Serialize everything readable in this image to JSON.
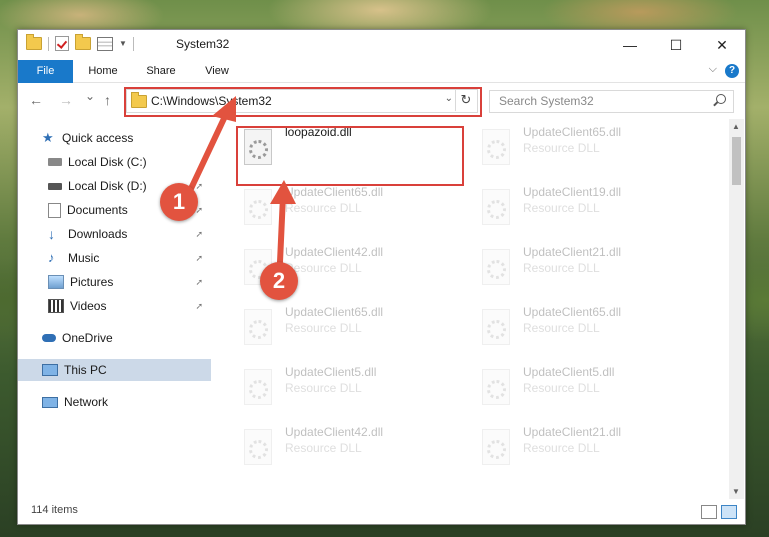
{
  "window": {
    "title": "System32",
    "controls": {
      "minimize": "—",
      "maximize": "☐",
      "close": "✕"
    }
  },
  "ribbon": {
    "tabs": [
      "File",
      "Home",
      "Share",
      "View"
    ],
    "help": "?",
    "collapse": "⌵"
  },
  "nav": {
    "back": "←",
    "forward": "→",
    "recent": "⌄",
    "up": "↑",
    "address": "C:\\Windows\\System32",
    "search_placeholder": "Search System32",
    "refresh": "↻",
    "dropdown": "⌄"
  },
  "sidebar": {
    "items": [
      {
        "label": "Quick access",
        "icon": "star-icon",
        "pinned": false
      },
      {
        "label": "Local Disk (C:)",
        "icon": "drive-icon",
        "pinned": false
      },
      {
        "label": "Local Disk (D:)",
        "icon": "drive-icon",
        "pinned": true
      },
      {
        "label": "Documents",
        "icon": "documents-icon",
        "pinned": true
      },
      {
        "label": "Downloads",
        "icon": "download-icon",
        "pinned": true
      },
      {
        "label": "Music",
        "icon": "music-icon",
        "pinned": true
      },
      {
        "label": "Pictures",
        "icon": "pictures-icon",
        "pinned": true
      },
      {
        "label": "Videos",
        "icon": "videos-icon",
        "pinned": true
      },
      {
        "label": "OneDrive",
        "icon": "cloud-icon",
        "pinned": false
      },
      {
        "label": "This PC",
        "icon": "pc-icon",
        "pinned": false,
        "selected": true
      },
      {
        "label": "Network",
        "icon": "network-icon",
        "pinned": false
      }
    ],
    "pin_glyph": "📌"
  },
  "files": [
    {
      "name": "loopazoid.dll",
      "type": "",
      "highlighted": true
    },
    {
      "name": "UpdateClient65.dll",
      "type": "Resource DLL"
    },
    {
      "name": "UpdateClient65.dll",
      "type": "Resource DLL"
    },
    {
      "name": "UpdateClient19.dll",
      "type": "Resource DLL"
    },
    {
      "name": "UpdateClient42.dll",
      "type": "Resource DLL"
    },
    {
      "name": "UpdateClient21.dll",
      "type": "Resource DLL"
    },
    {
      "name": "UpdateClient65.dll",
      "type": "Resource DLL"
    },
    {
      "name": "UpdateClient65.dll",
      "type": "Resource DLL"
    },
    {
      "name": "UpdateClient5.dll",
      "type": "Resource DLL"
    },
    {
      "name": "UpdateClient5.dll",
      "type": "Resource DLL"
    },
    {
      "name": "UpdateClient42.dll",
      "type": "Resource DLL"
    },
    {
      "name": "UpdateClient21.dll",
      "type": "Resource DLL"
    }
  ],
  "status": {
    "item_count": "114 items"
  },
  "annotations": {
    "step1": "1",
    "step2": "2"
  },
  "colors": {
    "accent": "#1979ca",
    "highlight_box": "#d9403a",
    "badge": "#e2533f",
    "selected_nav": "#ccd9e8"
  }
}
